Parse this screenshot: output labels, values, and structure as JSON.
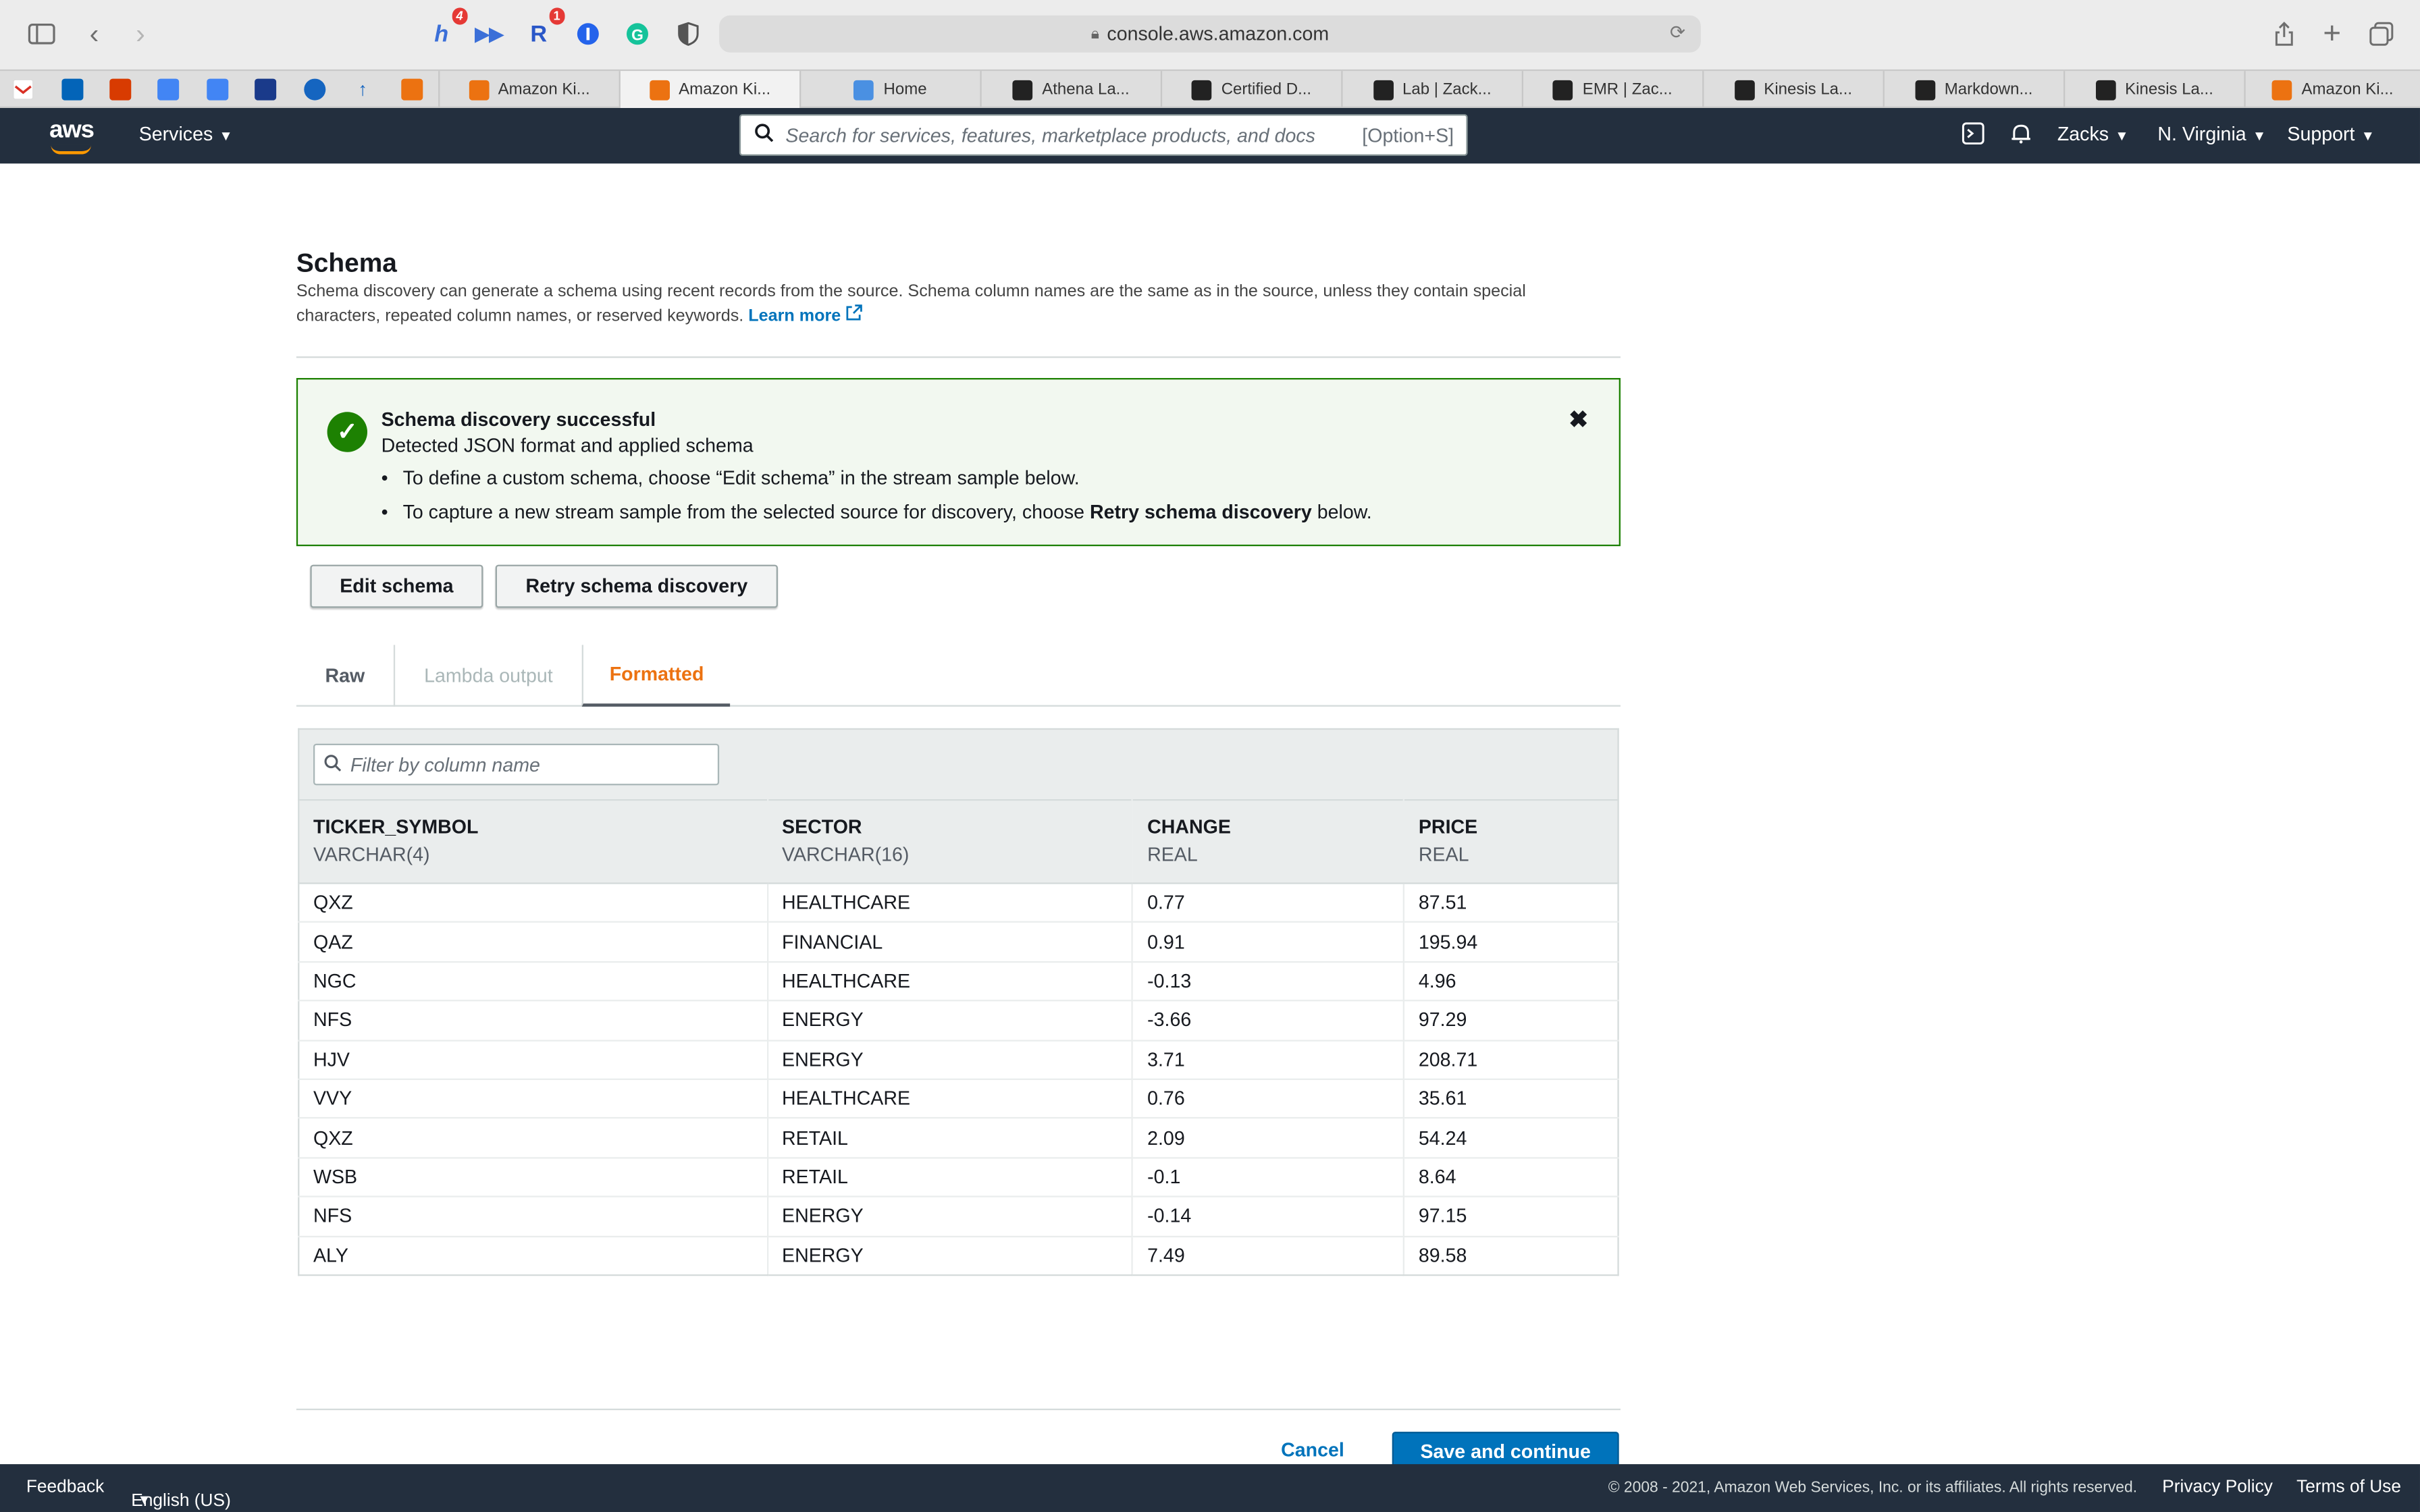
{
  "browser": {
    "url": "console.aws.amazon.com",
    "extension_badges": [
      "4",
      "1"
    ],
    "tabs": [
      {
        "label": "Amazon Ki...",
        "icon": "aws-cube-icon"
      },
      {
        "label": "Amazon Ki...",
        "icon": "aws-cube-icon",
        "active": true
      },
      {
        "label": "Home",
        "icon": "image-icon"
      },
      {
        "label": "Athena La...",
        "icon": "dark-square-icon"
      },
      {
        "label": "Certified D...",
        "icon": "dark-square-icon"
      },
      {
        "label": "Lab | Zack...",
        "icon": "dark-square-icon"
      },
      {
        "label": "EMR | Zac...",
        "icon": "dark-square-icon"
      },
      {
        "label": "Kinesis La...",
        "icon": "dark-square-icon"
      },
      {
        "label": "Markdown...",
        "icon": "dark-square-icon"
      },
      {
        "label": "Kinesis La...",
        "icon": "dark-square-icon"
      },
      {
        "label": "Amazon Ki...",
        "icon": "aws-cube-icon"
      }
    ]
  },
  "aws_nav": {
    "logo": "aws",
    "services": "Services",
    "search_placeholder": "Search for services, features, marketplace products, and docs",
    "search_shortcut": "[Option+S]",
    "user": "Zacks",
    "region": "N. Virginia",
    "support": "Support"
  },
  "schema": {
    "title": "Schema",
    "description": "Schema discovery can generate a schema using recent records from the source. Schema column names are the same as in the source, unless they contain special characters, repeated column names, or reserved keywords.",
    "learn_more": "Learn more"
  },
  "alert": {
    "title": "Schema discovery successful",
    "subtitle": "Detected JSON format and applied schema",
    "bullet1": "To define a custom schema, choose “Edit schema” in the stream sample below.",
    "bullet2_prefix": "To capture a new stream sample from the selected source for discovery, choose ",
    "bullet2_bold": "Retry schema discovery",
    "bullet2_suffix": " below."
  },
  "buttons": {
    "edit_schema": "Edit schema",
    "retry": "Retry schema discovery",
    "cancel": "Cancel",
    "save": "Save and continue"
  },
  "tabs": {
    "raw": "Raw",
    "lambda": "Lambda output",
    "formatted": "Formatted"
  },
  "filter": {
    "placeholder": "Filter by column name"
  },
  "table": {
    "columns": [
      {
        "name": "TICKER_SYMBOL",
        "type": "VARCHAR(4)"
      },
      {
        "name": "SECTOR",
        "type": "VARCHAR(16)"
      },
      {
        "name": "CHANGE",
        "type": "REAL"
      },
      {
        "name": "PRICE",
        "type": "REAL"
      }
    ],
    "rows": [
      [
        "QXZ",
        "HEALTHCARE",
        "0.77",
        "87.51"
      ],
      [
        "QAZ",
        "FINANCIAL",
        "0.91",
        "195.94"
      ],
      [
        "NGC",
        "HEALTHCARE",
        "-0.13",
        "4.96"
      ],
      [
        "NFS",
        "ENERGY",
        "-3.66",
        "97.29"
      ],
      [
        "HJV",
        "ENERGY",
        "3.71",
        "208.71"
      ],
      [
        "VVY",
        "HEALTHCARE",
        "0.76",
        "35.61"
      ],
      [
        "QXZ",
        "RETAIL",
        "2.09",
        "54.24"
      ],
      [
        "WSB",
        "RETAIL",
        "-0.1",
        "8.64"
      ],
      [
        "NFS",
        "ENERGY",
        "-0.14",
        "97.15"
      ],
      [
        "ALY",
        "ENERGY",
        "7.49",
        "89.58"
      ]
    ]
  },
  "footer": {
    "feedback": "Feedback",
    "language": "English (US)",
    "copyright": "© 2008 - 2021, Amazon Web Services, Inc. or its affiliates. All rights reserved.",
    "privacy": "Privacy Policy",
    "terms": "Terms of Use"
  },
  "colors": {
    "aws_nav": "#232f3e",
    "aws_orange": "#ff9900",
    "link_blue": "#0073bb",
    "success_green": "#1d8102",
    "tab_active": "#ec7211"
  }
}
